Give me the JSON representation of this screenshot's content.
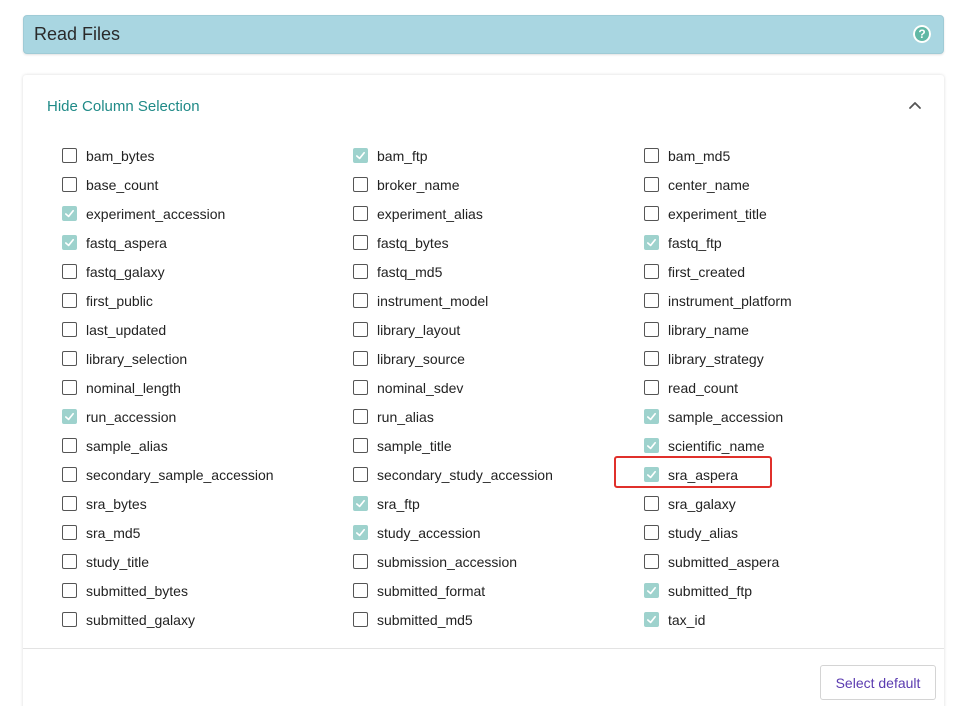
{
  "header": {
    "title": "Read Files",
    "help_icon": "?"
  },
  "panel": {
    "toggle_label": "Hide Column Selection",
    "collapse_icon": "chevron-up"
  },
  "accent_color": "#1f8a87",
  "checked_color": "#9ed2cd",
  "highlight_color": "#e0302b",
  "columns": [
    [
      {
        "label": "bam_bytes",
        "checked": false
      },
      {
        "label": "base_count",
        "checked": false
      },
      {
        "label": "experiment_accession",
        "checked": true
      },
      {
        "label": "fastq_aspera",
        "checked": true
      },
      {
        "label": "fastq_galaxy",
        "checked": false
      },
      {
        "label": "first_public",
        "checked": false
      },
      {
        "label": "last_updated",
        "checked": false
      },
      {
        "label": "library_selection",
        "checked": false
      },
      {
        "label": "nominal_length",
        "checked": false
      },
      {
        "label": "run_accession",
        "checked": true
      },
      {
        "label": "sample_alias",
        "checked": false
      },
      {
        "label": "secondary_sample_accession",
        "checked": false
      },
      {
        "label": "sra_bytes",
        "checked": false
      },
      {
        "label": "sra_md5",
        "checked": false
      },
      {
        "label": "study_title",
        "checked": false
      },
      {
        "label": "submitted_bytes",
        "checked": false
      },
      {
        "label": "submitted_galaxy",
        "checked": false
      }
    ],
    [
      {
        "label": "bam_ftp",
        "checked": true
      },
      {
        "label": "broker_name",
        "checked": false
      },
      {
        "label": "experiment_alias",
        "checked": false
      },
      {
        "label": "fastq_bytes",
        "checked": false
      },
      {
        "label": "fastq_md5",
        "checked": false
      },
      {
        "label": "instrument_model",
        "checked": false
      },
      {
        "label": "library_layout",
        "checked": false
      },
      {
        "label": "library_source",
        "checked": false
      },
      {
        "label": "nominal_sdev",
        "checked": false
      },
      {
        "label": "run_alias",
        "checked": false
      },
      {
        "label": "sample_title",
        "checked": false
      },
      {
        "label": "secondary_study_accession",
        "checked": false
      },
      {
        "label": "sra_ftp",
        "checked": true
      },
      {
        "label": "study_accession",
        "checked": true
      },
      {
        "label": "submission_accession",
        "checked": false
      },
      {
        "label": "submitted_format",
        "checked": false
      },
      {
        "label": "submitted_md5",
        "checked": false
      }
    ],
    [
      {
        "label": "bam_md5",
        "checked": false
      },
      {
        "label": "center_name",
        "checked": false
      },
      {
        "label": "experiment_title",
        "checked": false
      },
      {
        "label": "fastq_ftp",
        "checked": true
      },
      {
        "label": "first_created",
        "checked": false
      },
      {
        "label": "instrument_platform",
        "checked": false
      },
      {
        "label": "library_name",
        "checked": false
      },
      {
        "label": "library_strategy",
        "checked": false
      },
      {
        "label": "read_count",
        "checked": false
      },
      {
        "label": "sample_accession",
        "checked": true
      },
      {
        "label": "scientific_name",
        "checked": true
      },
      {
        "label": "sra_aspera",
        "checked": true,
        "highlighted": true
      },
      {
        "label": "sra_galaxy",
        "checked": false
      },
      {
        "label": "study_alias",
        "checked": false
      },
      {
        "label": "submitted_aspera",
        "checked": false
      },
      {
        "label": "submitted_ftp",
        "checked": true
      },
      {
        "label": "tax_id",
        "checked": true
      }
    ]
  ],
  "footer": {
    "select_default_label": "Select default"
  }
}
